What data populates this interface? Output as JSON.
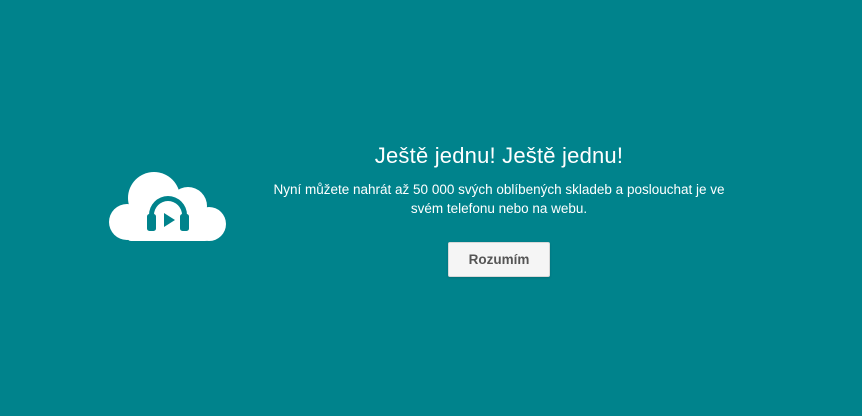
{
  "colors": {
    "background": "#00838c",
    "text": "#ffffff",
    "button_bg": "#f5f5f5",
    "button_text": "#555555"
  },
  "logo": {
    "icon": "cloud-headphones-icon"
  },
  "dialog": {
    "title": "Ještě jednu! Ještě jednu!",
    "message": "Nyní můžete nahrát až 50 000 svých oblíbených skladeb a poslouchat je ve svém telefonu nebo na webu.",
    "button_label": "Rozumím"
  }
}
